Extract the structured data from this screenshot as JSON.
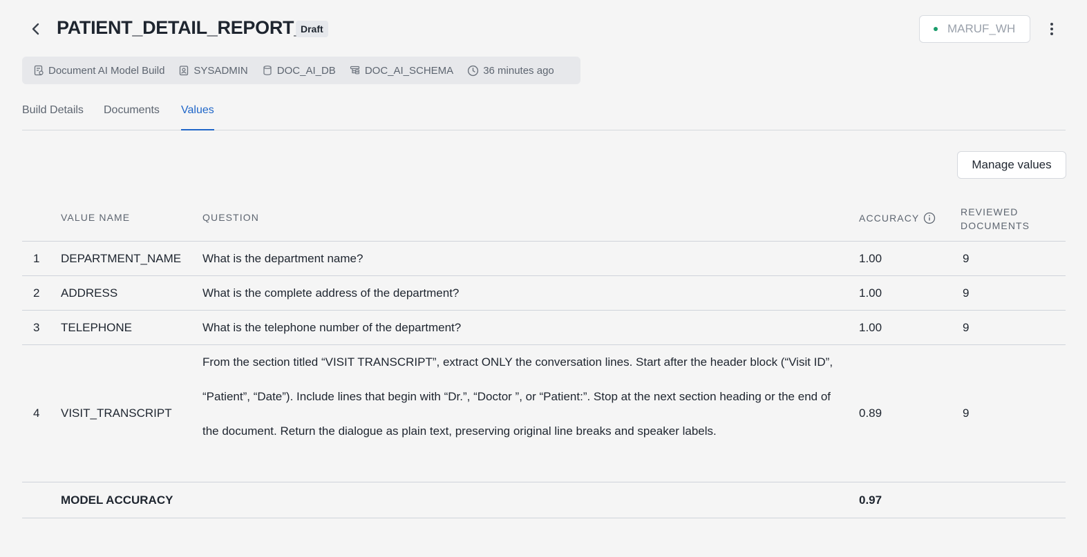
{
  "header": {
    "title": "PATIENT_DETAIL_REPORT_1",
    "status_badge": "Draft",
    "warehouse": "MARUF_WH"
  },
  "meta": {
    "type": "Document AI Model Build",
    "owner": "SYSADMIN",
    "database": "DOC_AI_DB",
    "schema": "DOC_AI_SCHEMA",
    "updated": "36 minutes ago"
  },
  "tabs": [
    {
      "label": "Build Details",
      "active": false
    },
    {
      "label": "Documents",
      "active": false
    },
    {
      "label": "Values",
      "active": true
    }
  ],
  "actions": {
    "manage_values": "Manage values"
  },
  "table": {
    "headers": {
      "value_name": "VALUE NAME",
      "question": "QUESTION",
      "accuracy": "ACCURACY",
      "reviewed_line1": "REVIEWED",
      "reviewed_line2": "DOCUMENTS"
    },
    "rows": [
      {
        "index": "1",
        "name": "DEPARTMENT_NAME",
        "question": "What is the department name?",
        "accuracy": "1.00",
        "reviewed": "9"
      },
      {
        "index": "2",
        "name": "ADDRESS",
        "question": "What is the complete address of the department?",
        "accuracy": "1.00",
        "reviewed": "9"
      },
      {
        "index": "3",
        "name": "TELEPHONE",
        "question": "What is the telephone number of the department?",
        "accuracy": "1.00",
        "reviewed": "9"
      },
      {
        "index": "4",
        "name": "VISIT_TRANSCRIPT",
        "question": "From the section titled “VISIT TRANSCRIPT”, extract ONLY the conversation lines. Start after the header block (“Visit ID”, “Patient”, “Date”). Include lines that begin with “Dr.”, “Doctor ”, or “Patient:”. Stop at the next section heading or the end of the document. Return the dialogue as plain text, preserving original line breaks and speaker labels.",
        "accuracy": "0.89",
        "reviewed": "9"
      }
    ],
    "footer": {
      "label": "MODEL ACCURACY",
      "accuracy": "0.97"
    }
  },
  "colors": {
    "accent": "#1f66c8",
    "warehouse_status": "#1a9c6b",
    "background": "#f5f5f5"
  },
  "icons": [
    "chevron-left-icon",
    "more-vertical-icon",
    "document-model-icon",
    "user-badge-icon",
    "database-icon",
    "schema-icon",
    "clock-icon",
    "info-icon"
  ]
}
